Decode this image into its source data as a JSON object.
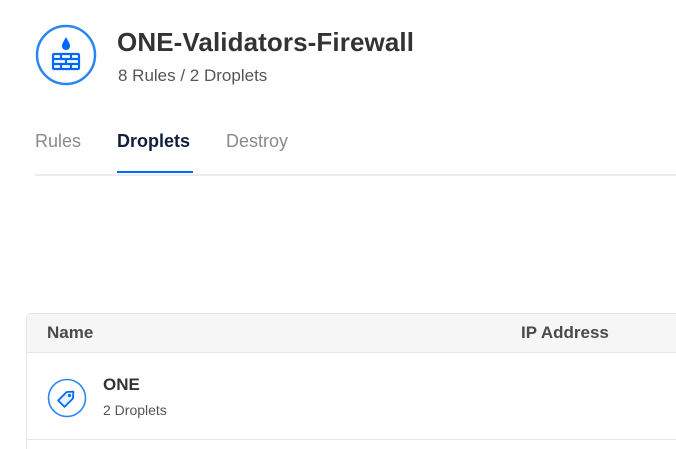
{
  "firewall": {
    "title": "ONE-Validators-Firewall",
    "subtitle": "8 Rules / 2 Droplets",
    "icon": "firewall-icon"
  },
  "tabs": [
    {
      "label": "Rules",
      "active": false
    },
    {
      "label": "Droplets",
      "active": true
    },
    {
      "label": "Destroy",
      "active": false
    }
  ],
  "table": {
    "columns": [
      "Name",
      "IP Address"
    ],
    "rows": [
      {
        "name": "ONE",
        "sub": "2 Droplets",
        "ip": "",
        "icon": "tag-icon"
      }
    ]
  },
  "colors": {
    "accent": "#0069ff",
    "icon_blue": "#2b86f5"
  }
}
